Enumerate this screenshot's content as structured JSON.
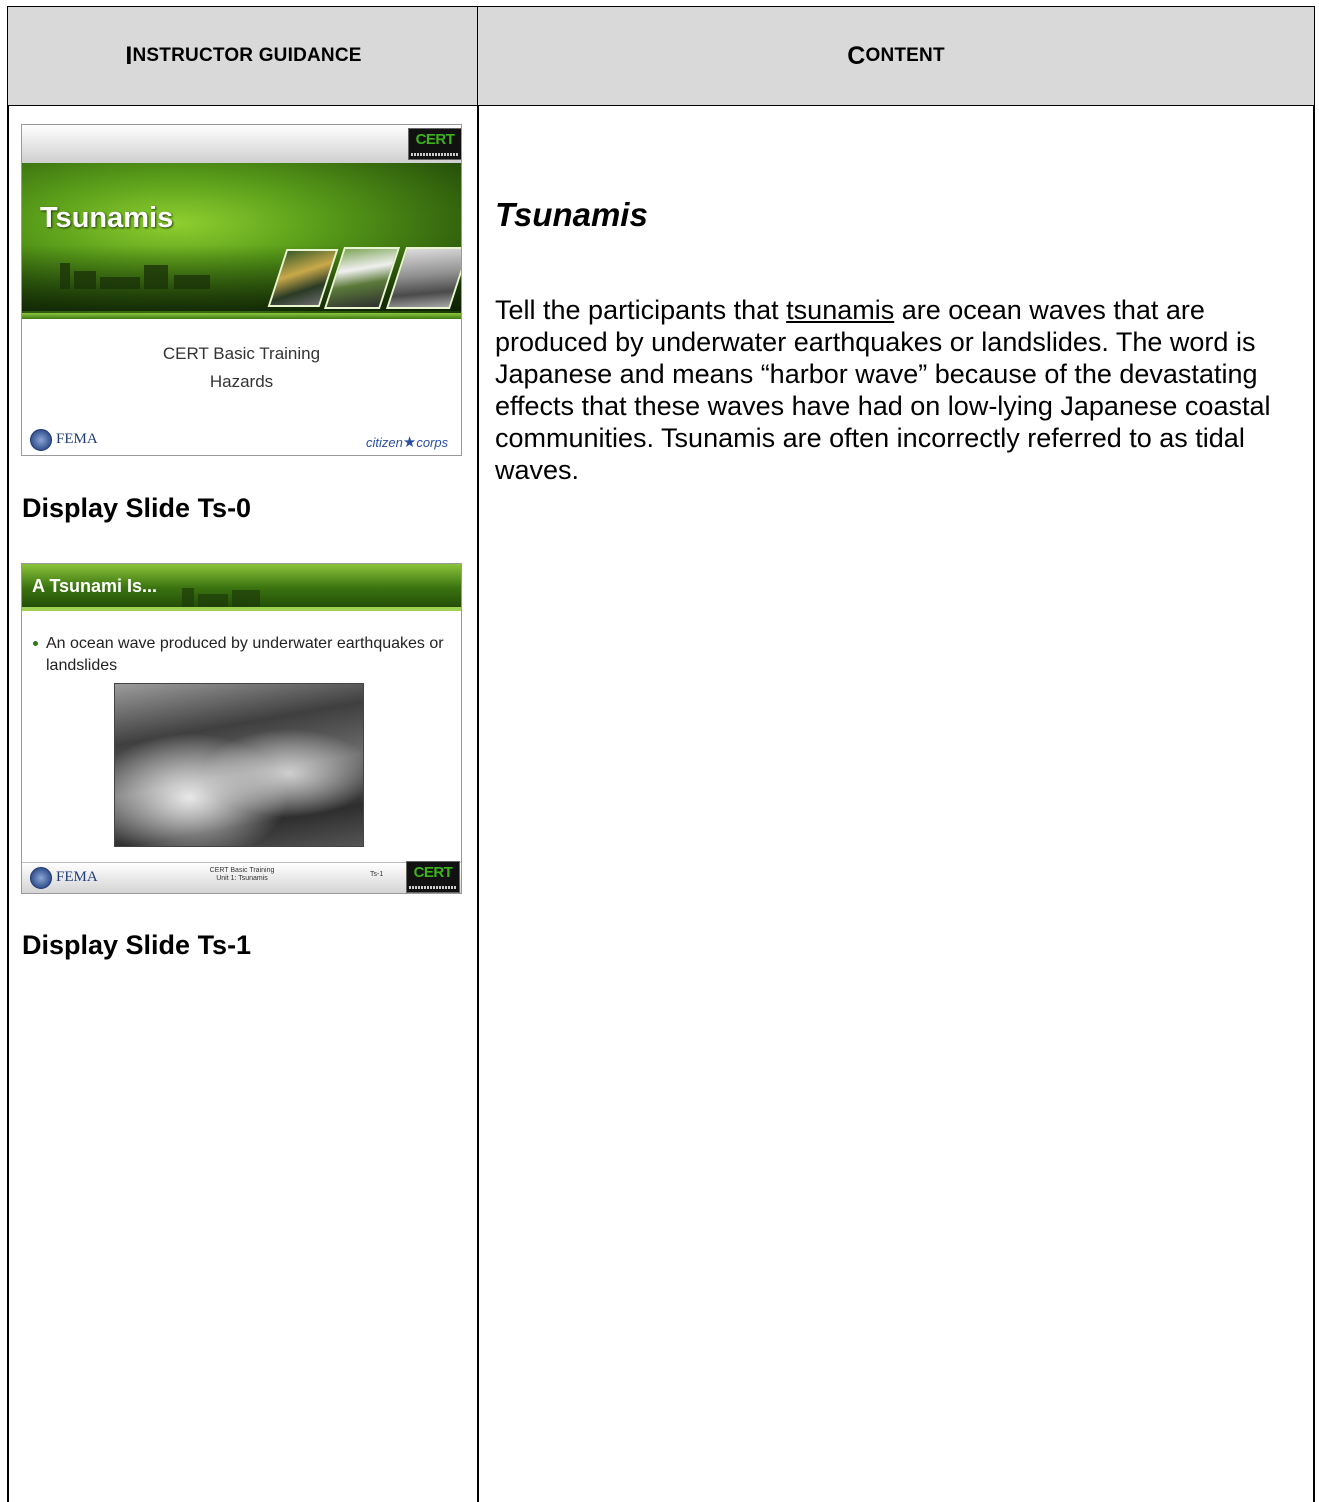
{
  "header": {
    "left_cap": "I",
    "left_rest": "NSTRUCTOR GUIDANCE",
    "right_cap": "C",
    "right_rest": "ONTENT"
  },
  "slides": [
    {
      "title": "Tsunamis",
      "subtitle_1": "CERT Basic Training",
      "subtitle_2": "Hazards",
      "logo_left": "FEMA",
      "logo_right_1": "citizen",
      "logo_right_2": "corps",
      "badge": "CERT",
      "caption": "Display Slide Ts-0"
    },
    {
      "title": "A Tsunami Is...",
      "bullet": "An ocean wave produced by underwater earthquakes or landslides",
      "footer_1": "CERT Basic Training",
      "footer_2": "Unit 1: Tsunamis",
      "slide_number": "Ts-1",
      "logo_left": "FEMA",
      "badge": "CERT",
      "caption": "Display Slide Ts-1"
    }
  ],
  "content": {
    "title": "Tsunamis",
    "para_before": "Tell the participants that ",
    "para_term": "tsunamis",
    "para_after": " are ocean waves that are produced by underwater earthquakes or landslides. The word is Japanese and means “harbor wave” because of the devastating effects that these waves have had on low-lying Japanese coastal communities. Tsunamis are often incorrectly referred to as tidal waves."
  }
}
